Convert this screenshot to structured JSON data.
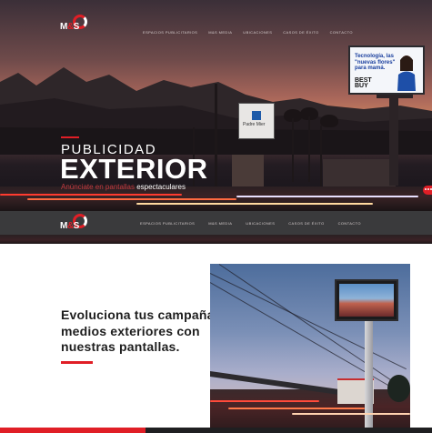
{
  "brand": {
    "logo_text_m": "M",
    "logo_text_amp": "&",
    "logo_text_s": "S",
    "accent": "#e01e26",
    "nav_bg": "#3a3a3c"
  },
  "nav": {
    "items": [
      {
        "label": "Espacios Publicitarios"
      },
      {
        "label": "M&S Media"
      },
      {
        "label": "Ubicaciones"
      },
      {
        "label": "Casos de Éxito"
      },
      {
        "label": "Contacto"
      }
    ]
  },
  "hero": {
    "title_line1": "PUBLICIDAD",
    "title_line2": "EXTERIOR",
    "subtitle_prefix": "Anúnciate en pantallas",
    "subtitle_highlight": "espectaculares"
  },
  "billboard": {
    "headline": "Tecnología, las \"nuevas flores\" para mamá.",
    "brand": "BEST BUY"
  },
  "street_sign": {
    "text": "Padre Mier"
  },
  "sticky_nav": {
    "items": [
      {
        "label": "Espacios Publicitarios"
      },
      {
        "label": "M&S Media"
      },
      {
        "label": "Ubicaciones"
      },
      {
        "label": "Casos de Éxito"
      },
      {
        "label": "Contacto"
      }
    ]
  },
  "content": {
    "headline": "Evoluciona tus campañas en medios exteriores con nuestras pantallas."
  },
  "icons": {
    "chat": "chat-bubble-icon",
    "logo": "ms-logo-icon"
  }
}
